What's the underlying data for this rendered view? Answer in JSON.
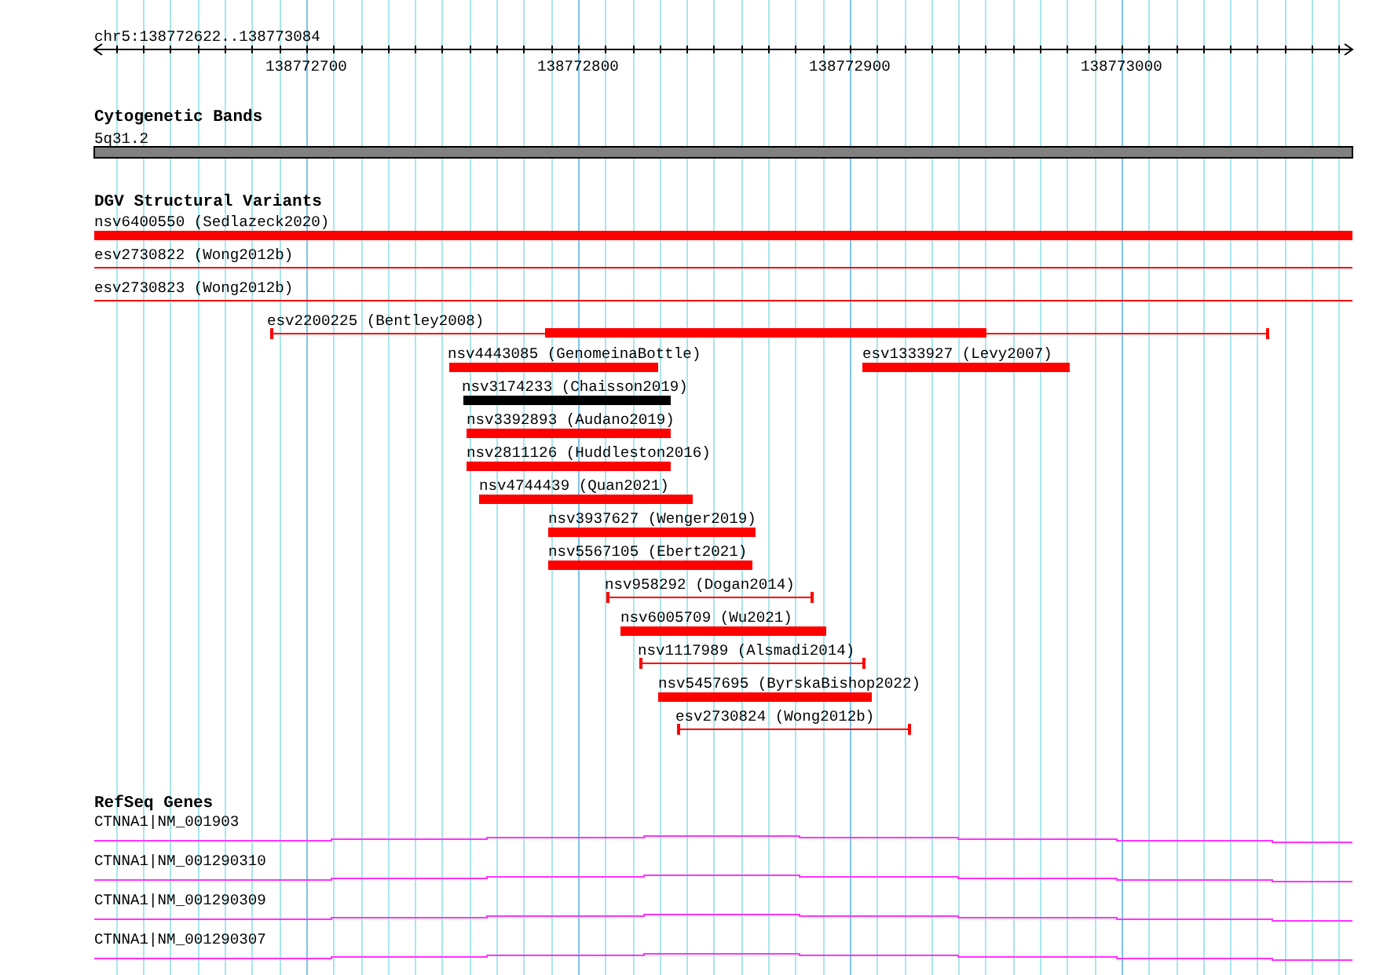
{
  "ruler": {
    "location": "chr5:138772622..138773084",
    "tick_labels": [
      "138772700",
      "138772800",
      "138772900",
      "138773000"
    ]
  },
  "tracks": [
    {
      "kind": "cytoband",
      "title": "Cytogenetic Bands",
      "band": "5q31.2"
    },
    {
      "kind": "variants",
      "title": "DGV Structural Variants",
      "features": [
        {
          "label": "nsv6400550 (Sedlazeck2020)",
          "kind": "bar",
          "color": "#ff0000"
        },
        {
          "label": "esv2730822 (Wong2012b)",
          "kind": "line",
          "color": "#ff0000"
        },
        {
          "label": "esv2730823 (Wong2012b)",
          "kind": "line",
          "color": "#ff0000"
        },
        {
          "label": "esv2200225 (Bentley2008)",
          "kind": "span",
          "color": "#ff0000"
        },
        {
          "label": "nsv4443085 (GenomeinaBottle)",
          "kind": "bar",
          "color": "#ff0000"
        },
        {
          "label": "esv1333927 (Levy2007)",
          "kind": "bar",
          "color": "#ff0000"
        },
        {
          "label": "nsv3174233 (Chaisson2019)",
          "kind": "bar",
          "color": "#000000"
        },
        {
          "label": "nsv3392893 (Audano2019)",
          "kind": "bar",
          "color": "#ff0000"
        },
        {
          "label": "nsv2811126 (Huddleston2016)",
          "kind": "bar",
          "color": "#ff0000"
        },
        {
          "label": "nsv4744439 (Quan2021)",
          "kind": "bar",
          "color": "#ff0000"
        },
        {
          "label": "nsv3937627 (Wenger2019)",
          "kind": "bar",
          "color": "#ff0000"
        },
        {
          "label": "nsv5567105 (Ebert2021)",
          "kind": "bar",
          "color": "#ff0000"
        },
        {
          "label": "nsv958292 (Dogan2014)",
          "kind": "span",
          "color": "#ff0000"
        },
        {
          "label": "nsv6005709 (Wu2021)",
          "kind": "bar",
          "color": "#ff0000"
        },
        {
          "label": "nsv1117989 (Alsmadi2014)",
          "kind": "span",
          "color": "#ff0000"
        },
        {
          "label": "nsv5457695 (ByrskaBishop2022)",
          "kind": "bar",
          "color": "#ff0000"
        },
        {
          "label": "esv2730824 (Wong2012b)",
          "kind": "span",
          "color": "#ff0000"
        }
      ]
    },
    {
      "kind": "genes",
      "title": "RefSeq Genes",
      "features": [
        {
          "label": "CTNNA1|NM_001903"
        },
        {
          "label": "CTNNA1|NM_001290310"
        },
        {
          "label": "CTNNA1|NM_001290309"
        },
        {
          "label": "CTNNA1|NM_001290307"
        }
      ]
    }
  ]
}
